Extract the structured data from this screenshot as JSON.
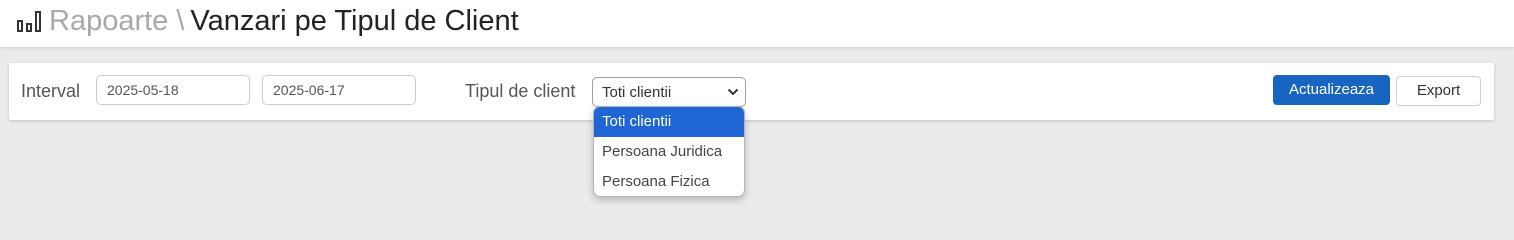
{
  "header": {
    "breadcrumb_parent": "Rapoarte",
    "breadcrumb_separator": "\\",
    "page_title": "Vanzari pe Tipul de Client",
    "icon": "bar-chart-icon"
  },
  "filters": {
    "interval_label": "Interval",
    "date_from": "2025-05-18",
    "date_to": "2025-06-17",
    "client_type_label": "Tipul de client",
    "client_type_selected": "Toti clientii",
    "client_type_options": [
      "Toti clientii",
      "Persoana Juridica",
      "Persoana Fizica"
    ],
    "dropdown_open": true,
    "chevron_icon": "chevron-down-icon"
  },
  "actions": {
    "update_label": "Actualizeaza",
    "export_label": "Export"
  },
  "colors": {
    "primary": "#1765c0",
    "selected_option": "#1f66d4",
    "background": "#ebebeb",
    "muted_text": "#a8a8a8"
  }
}
